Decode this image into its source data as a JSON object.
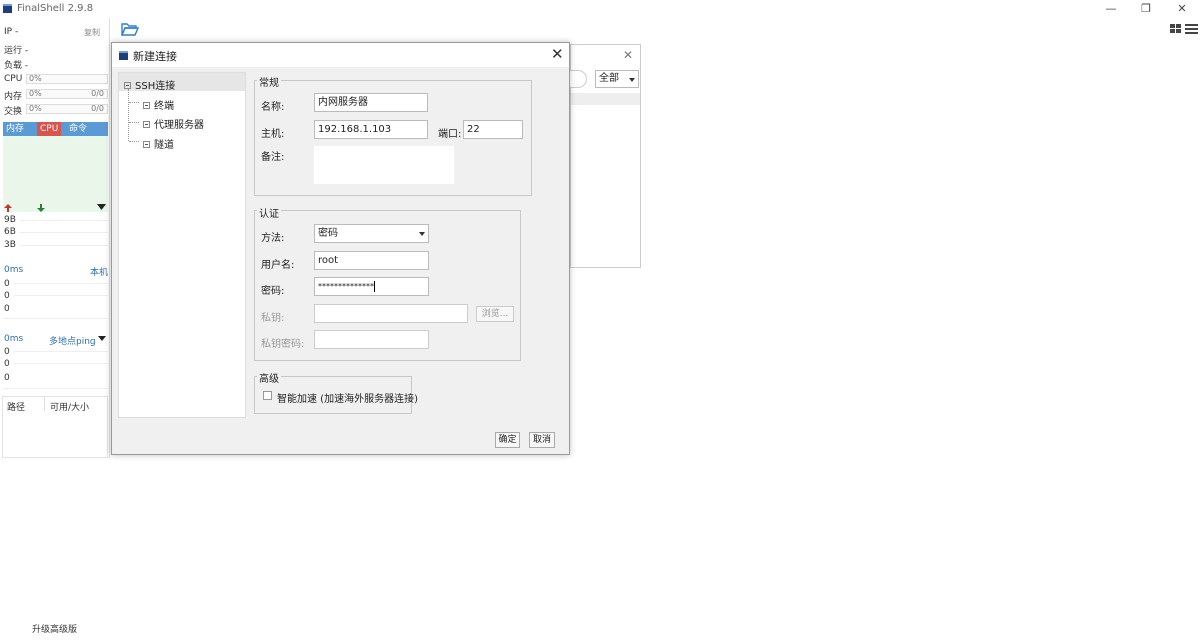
{
  "app": {
    "title": "FinalShell 2.9.8",
    "minimize": "—",
    "restore": "❐",
    "close": "✕"
  },
  "left": {
    "ip_label": "IP  -",
    "copy": "复制",
    "run_label": "运行 -",
    "load_label": "负载 -",
    "cpu_label": "CPU",
    "cpu_value": "0%",
    "mem_label": "内存",
    "mem_value": "0%",
    "mem_size": "0/0",
    "swap_label": "交换",
    "swap_value": "0%",
    "swap_size": "0/0",
    "tabs": {
      "mem": "内存",
      "cpu": "CPU",
      "cmd": "命令"
    },
    "net": {
      "v1": "9B",
      "v2": "6B",
      "v3": "3B"
    },
    "latency1": {
      "value": "0ms",
      "target": "本机",
      "r1": "0",
      "r2": "0",
      "r3": "0"
    },
    "latency2": {
      "value": "0ms",
      "target": "多地点ping",
      "r1": "0",
      "r2": "0",
      "r3": "0"
    },
    "disk": {
      "col_path": "路径",
      "col_size": "可用/大小"
    }
  },
  "background_window": {
    "close": "✕",
    "filter_value": "全部"
  },
  "dialog": {
    "title": "新建连接",
    "close": "✕",
    "tree": {
      "root": "SSH连接",
      "items": [
        "终端",
        "代理服务器",
        "隧道"
      ]
    },
    "general": {
      "legend": "常规",
      "name_label": "名称:",
      "name_value": "内网服务器",
      "host_label": "主机:",
      "host_value": "192.168.1.103",
      "port_label": "端口:",
      "port_value": "22",
      "note_label": "备注:",
      "note_value": ""
    },
    "auth": {
      "legend": "认证",
      "method_label": "方法:",
      "method_value": "密码",
      "user_label": "用户名:",
      "user_value": "root",
      "pass_label": "密码:",
      "pass_value": "**************",
      "key_label": "私钥:",
      "browse_label": "浏览...",
      "key_pass_label": "私钥密码:"
    },
    "advanced": {
      "legend": "高级",
      "accel_label": "智能加速 (加速海外服务器连接)"
    },
    "ok": "确定",
    "cancel": "取消"
  },
  "footer": {
    "upgrade": "升级高级版"
  },
  "colors": {
    "accent": "#5b9bd5",
    "cpu_tab": "#d9534f",
    "graph_bg": "#ebf6eb"
  }
}
